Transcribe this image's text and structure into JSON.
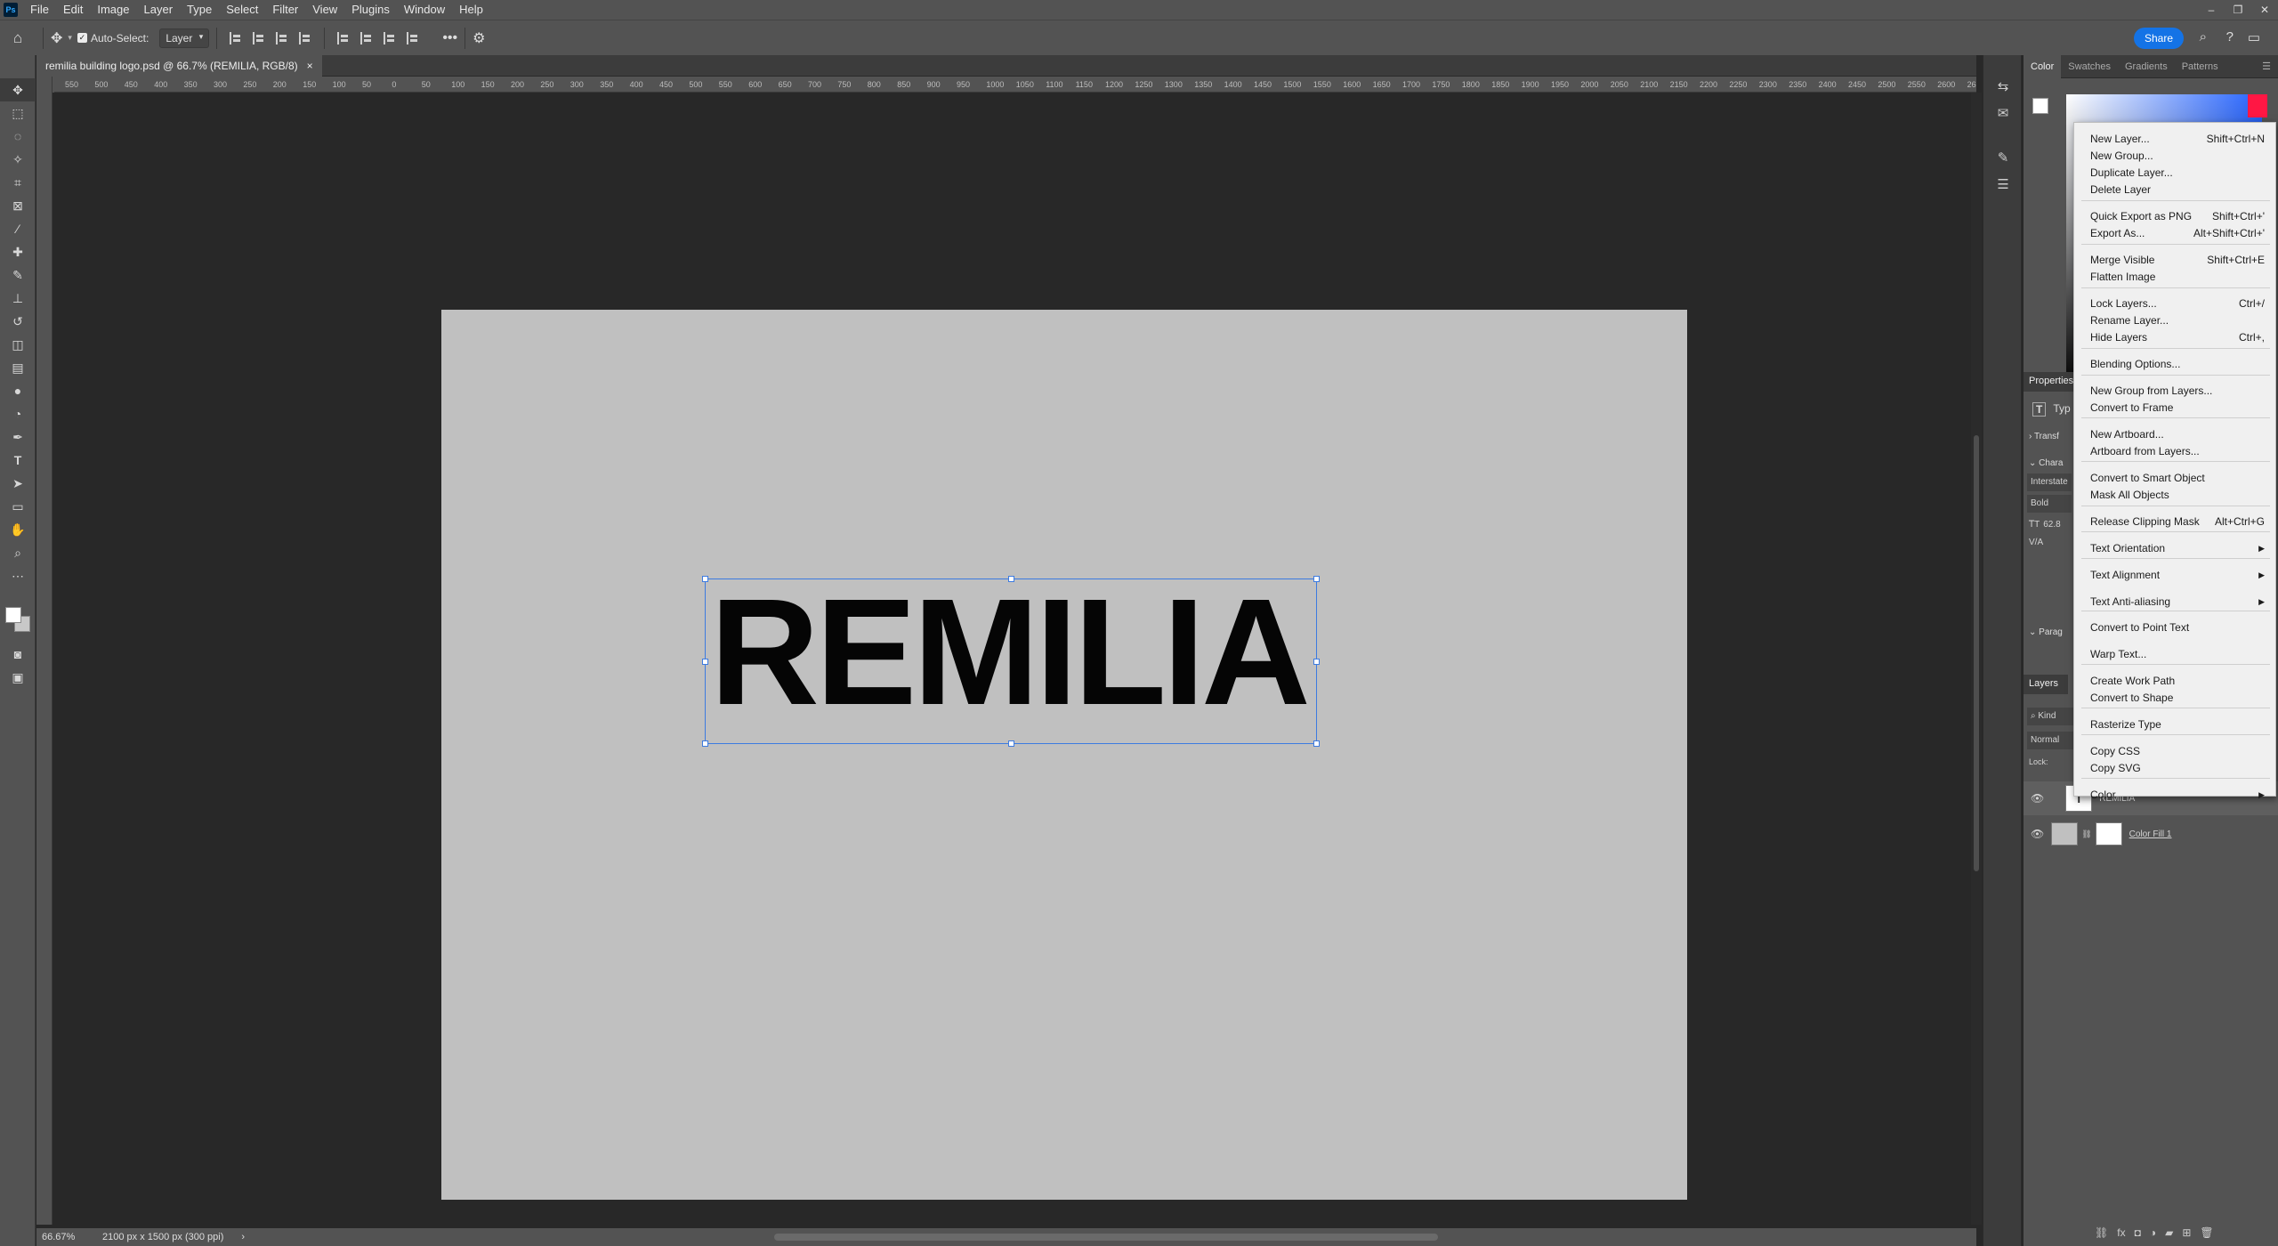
{
  "app": {
    "logo": "Ps"
  },
  "menubar": [
    "File",
    "Edit",
    "Image",
    "Layer",
    "Type",
    "Select",
    "Filter",
    "View",
    "Plugins",
    "Window",
    "Help"
  ],
  "options": {
    "auto_select_label": "Auto-Select:",
    "auto_select_target": "Layer",
    "share_label": "Share"
  },
  "document": {
    "tab_title": "remilia building logo.psd @ 66.7% (REMILIA, RGB/8)",
    "canvas_text": "REMILIA"
  },
  "ruler": [
    "550",
    "500",
    "450",
    "400",
    "350",
    "300",
    "250",
    "200",
    "150",
    "100",
    "50",
    "0",
    "50",
    "100",
    "150",
    "200",
    "250",
    "300",
    "350",
    "400",
    "450",
    "500",
    "550",
    "600",
    "650",
    "700",
    "750",
    "800",
    "850",
    "900",
    "950",
    "1000",
    "1050",
    "1100",
    "1150",
    "1200",
    "1250",
    "1300",
    "1350",
    "1400",
    "1450",
    "1500",
    "1550",
    "1600",
    "1650",
    "1700",
    "1750",
    "1800",
    "1850",
    "1900",
    "1950",
    "2000",
    "2050",
    "2100",
    "2150",
    "2200",
    "2250",
    "2300",
    "2350",
    "2400",
    "2450",
    "2500",
    "2550",
    "2600",
    "26"
  ],
  "status": {
    "zoom": "66.67%",
    "doc_info": "2100 px x 1500 px (300 ppi)"
  },
  "color_panel": {
    "tabs": [
      "Color",
      "Swatches",
      "Gradients",
      "Patterns"
    ],
    "hue_color": "#ff1744"
  },
  "properties": {
    "title": "Properties",
    "type_label": "Typ",
    "transform_label": "Transf",
    "character_label": "Chara",
    "font": "Interstate",
    "style": "Bold",
    "size": "62.8",
    "tracking": "V/A",
    "paragraph_label": "Parag"
  },
  "layers": {
    "title": "Layers",
    "kind_label": "Kind",
    "blend_mode": "Normal",
    "locks_label": "Lock:",
    "items": [
      {
        "name": "REMILIA"
      },
      {
        "name": "Color Fill 1"
      }
    ]
  },
  "context_menu": {
    "items": [
      {
        "label": "New Layer...",
        "shortcut": "Shift+Ctrl+N"
      },
      {
        "label": "New Group...",
        "shortcut": ""
      },
      {
        "label": "Duplicate Layer...",
        "shortcut": ""
      },
      {
        "label": "Delete Layer",
        "shortcut": ""
      },
      {
        "label": "Quick Export as PNG",
        "shortcut": "Shift+Ctrl+'"
      },
      {
        "label": "Export As...",
        "shortcut": "Alt+Shift+Ctrl+'"
      },
      {
        "label": "Merge Visible",
        "shortcut": "Shift+Ctrl+E"
      },
      {
        "label": "Flatten Image",
        "shortcut": ""
      },
      {
        "label": "Lock Layers...",
        "shortcut": "Ctrl+/"
      },
      {
        "label": "Rename Layer...",
        "shortcut": ""
      },
      {
        "label": "Hide Layers",
        "shortcut": "Ctrl+,"
      },
      {
        "label": "Blending Options...",
        "shortcut": ""
      },
      {
        "label": "New Group from Layers...",
        "shortcut": ""
      },
      {
        "label": "Convert to Frame",
        "shortcut": ""
      },
      {
        "label": "New Artboard...",
        "shortcut": ""
      },
      {
        "label": "Artboard from Layers...",
        "shortcut": ""
      },
      {
        "label": "Convert to Smart Object",
        "shortcut": ""
      },
      {
        "label": "Mask All Objects",
        "shortcut": ""
      },
      {
        "label": "Release Clipping Mask",
        "shortcut": "Alt+Ctrl+G"
      },
      {
        "label": "Text Orientation",
        "shortcut": ""
      },
      {
        "label": "Text Alignment",
        "shortcut": ""
      },
      {
        "label": "Text Anti-aliasing",
        "shortcut": ""
      },
      {
        "label": "Convert to Point Text",
        "shortcut": ""
      },
      {
        "label": "Warp Text...",
        "shortcut": ""
      },
      {
        "label": "Create Work Path",
        "shortcut": ""
      },
      {
        "label": "Convert to Shape",
        "shortcut": ""
      },
      {
        "label": "Rasterize Type",
        "shortcut": ""
      },
      {
        "label": "Copy CSS",
        "shortcut": ""
      },
      {
        "label": "Copy SVG",
        "shortcut": ""
      },
      {
        "label": "Color",
        "shortcut": ""
      }
    ]
  }
}
